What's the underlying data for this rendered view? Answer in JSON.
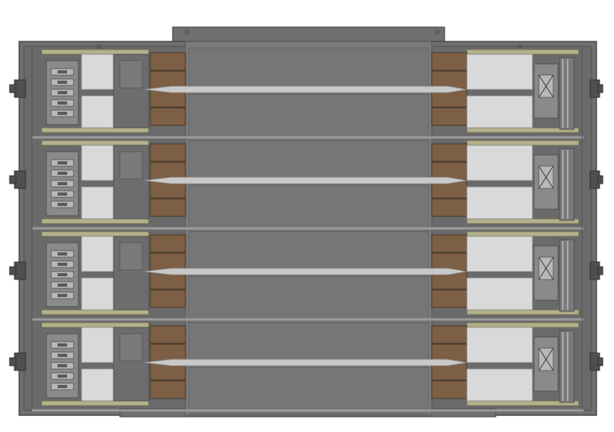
{
  "drawing": {
    "view": "section",
    "module_count": 4,
    "colors": {
      "background": "#ffffff",
      "housing": "#707070",
      "housing_edge": "#4a4a4a",
      "core": "#7b7b7b",
      "core_dark": "#5e5e5e",
      "pad": "#7c5f45",
      "pad_edge": "#3e2e20",
      "rail": "#b3b18a",
      "panel": "#d9d9d9",
      "panel_edge": "#8a8a8a",
      "shaft": "#c9c9c9",
      "bolt": "#4f4f4f",
      "wire": "#f2f2f2"
    }
  }
}
